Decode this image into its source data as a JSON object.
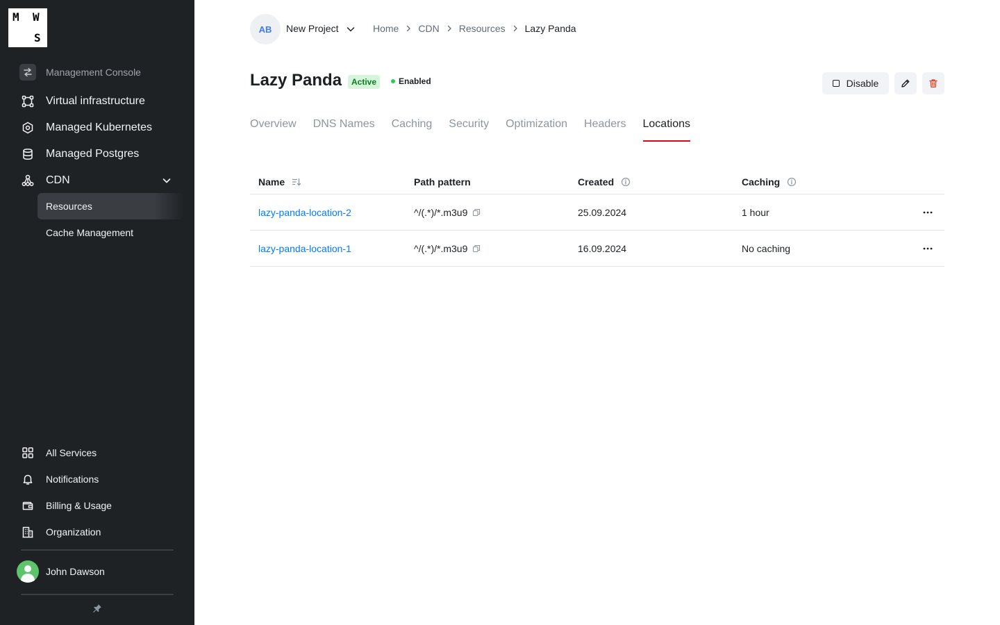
{
  "logo": {
    "letters": [
      "M",
      "W",
      "S"
    ]
  },
  "sidebar": {
    "console_label": "Management Console",
    "nav": [
      {
        "label": "Virtual infrastructure",
        "icon": "virtual-infrastructure-icon"
      },
      {
        "label": "Managed Kubernetes",
        "icon": "kubernetes-icon"
      },
      {
        "label": "Managed Postgres",
        "icon": "database-icon"
      },
      {
        "label": "CDN",
        "icon": "cdn-icon",
        "expanded": true
      }
    ],
    "cdn_sub": [
      {
        "label": "Resources",
        "active": true
      },
      {
        "label": "Cache Management",
        "active": false
      }
    ],
    "bottom": [
      {
        "label": "All Services",
        "icon": "grid-icon"
      },
      {
        "label": "Notifications",
        "icon": "bell-icon"
      },
      {
        "label": "Billing & Usage",
        "icon": "wallet-icon"
      },
      {
        "label": "Organization",
        "icon": "building-icon"
      }
    ],
    "user_name": "John Dawson"
  },
  "header": {
    "project_initials": "AB",
    "project_name": "New Project",
    "breadcrumb": [
      "Home",
      "CDN",
      "Resources",
      "Lazy Panda"
    ]
  },
  "resource": {
    "title": "Lazy Panda",
    "badge": "Active",
    "status": "Enabled",
    "disable_label": "Disable"
  },
  "tabs": [
    {
      "label": "Overview",
      "active": false
    },
    {
      "label": "DNS Names",
      "active": false
    },
    {
      "label": "Caching",
      "active": false
    },
    {
      "label": "Security",
      "active": false
    },
    {
      "label": "Optimization",
      "active": false
    },
    {
      "label": "Headers",
      "active": false
    },
    {
      "label": "Locations",
      "active": true
    }
  ],
  "table": {
    "columns": [
      "Name",
      "Path pattern",
      "Created",
      "Caching"
    ],
    "rows": [
      {
        "name": "lazy-panda-location-2",
        "path": "^/(.*)/*.m3u9",
        "created": "25.09.2024",
        "caching": "1 hour"
      },
      {
        "name": "lazy-panda-location-1",
        "path": "^/(.*)/*.m3u9",
        "created": "16.09.2024",
        "caching": "No caching"
      }
    ]
  },
  "colors": {
    "sidebar_bg": "#1f2225",
    "accent_red": "#e30611",
    "link_blue": "#007cff",
    "active_badge_bg": "#d6f5db",
    "active_badge_text": "#0f7b22",
    "enabled_dot": "#26cd58",
    "delete_icon": "#e34b2e"
  }
}
